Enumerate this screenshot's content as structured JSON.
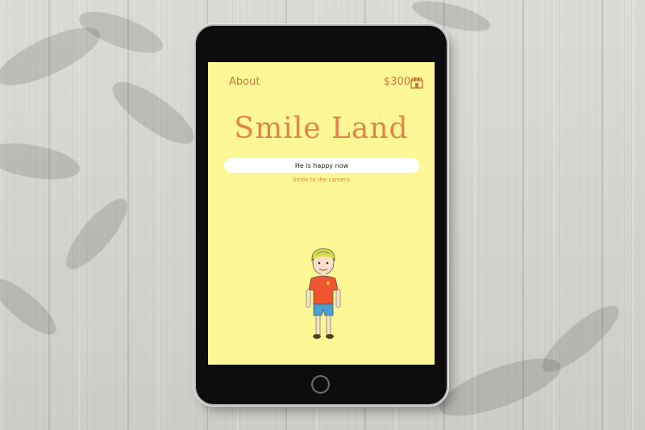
{
  "app": {
    "nav_about": "About",
    "balance": "$300",
    "title": "Smile Land",
    "status_input_value": "He is happy now",
    "hint_text": "Smile to the camera"
  },
  "icons": {
    "shop": "shop-icon",
    "home": "home-button-icon"
  },
  "colors": {
    "screen_bg": "#fdf895",
    "accent": "#e2834d",
    "text_accent": "#c9733e"
  }
}
